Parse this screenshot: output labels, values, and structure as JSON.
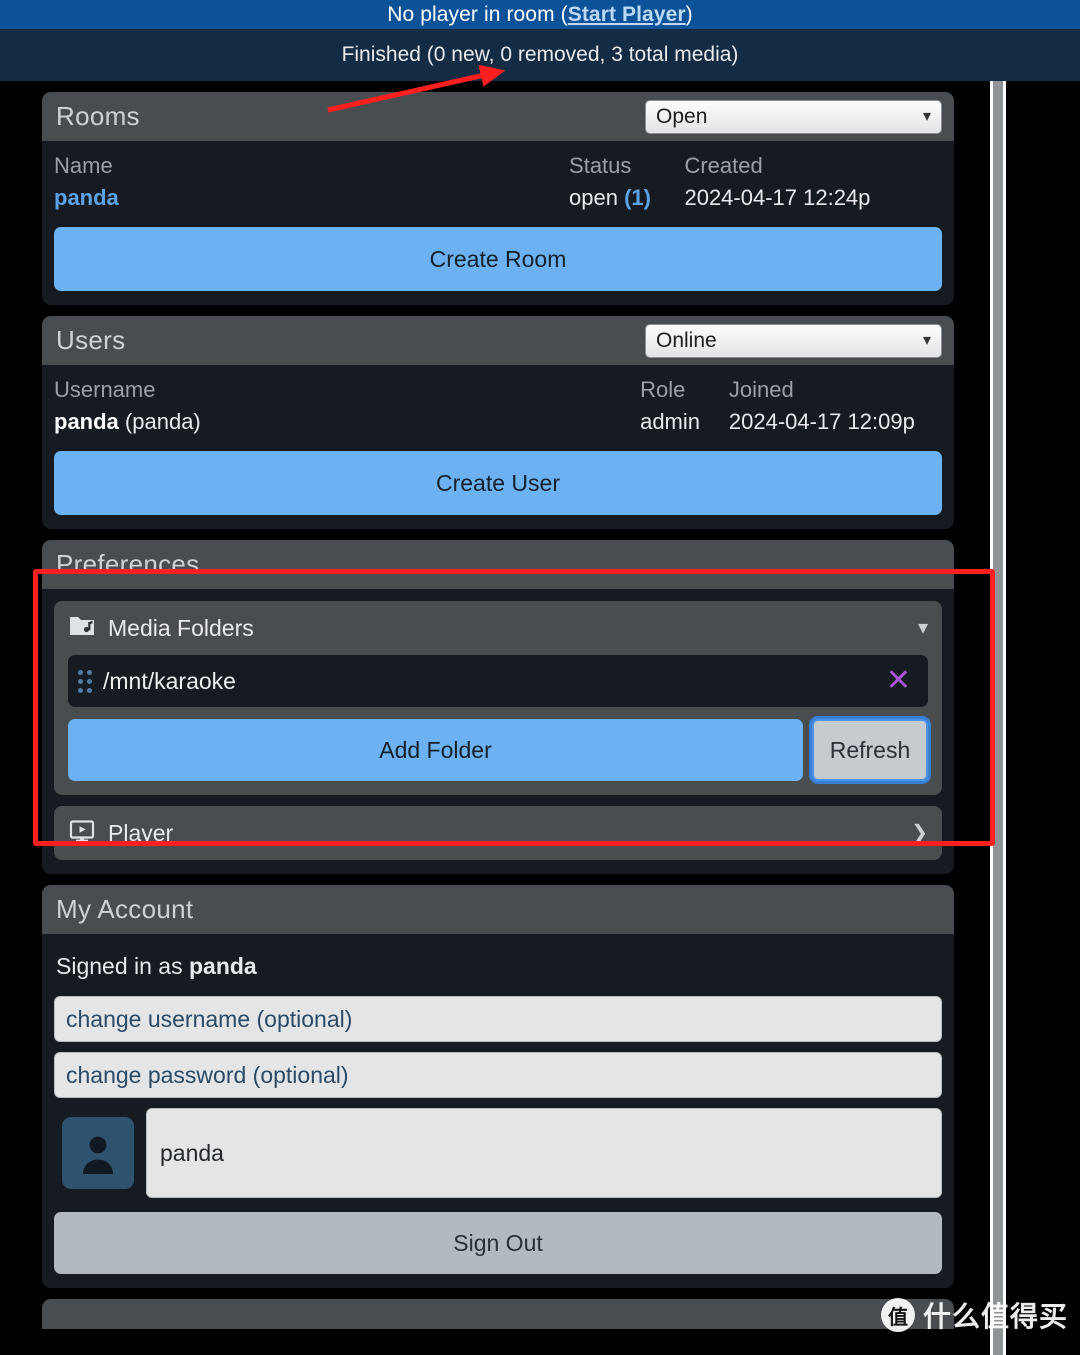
{
  "status_bars": {
    "player_prefix": "No player in room (",
    "player_link": "Start Player",
    "player_suffix": ")",
    "scan_status": "Finished (0 new, 0 removed, 3 total media)",
    "player_bar_color": "#0b5299",
    "scan_bar_color": "#132c44"
  },
  "rooms": {
    "title": "Rooms",
    "filter_value": "Open",
    "filter_options": [
      "Open"
    ],
    "columns": [
      "Name",
      "Status",
      "Created"
    ],
    "rows": [
      {
        "name": "panda",
        "status": "open",
        "count": "(1)",
        "created": "2024-04-17 12:24p"
      }
    ],
    "create_button": "Create Room"
  },
  "users": {
    "title": "Users",
    "filter_value": "Online",
    "filter_options": [
      "Online"
    ],
    "columns": [
      "Username",
      "Role",
      "Joined"
    ],
    "rows": [
      {
        "username_bold": "panda",
        "username_alias": "(panda)",
        "role": "admin",
        "joined": "2024-04-17 12:09p"
      }
    ],
    "create_button": "Create User"
  },
  "preferences": {
    "title": "Preferences",
    "media_folders": {
      "label": "Media Folders",
      "icon": "music-folder-icon",
      "expanded_caret": "chevron-down-icon",
      "folders": [
        {
          "path": "/mnt/karaoke",
          "remove_icon": "close-icon"
        }
      ],
      "add_button": "Add Folder",
      "refresh_button": "Refresh"
    },
    "player": {
      "label": "Player",
      "icon": "monitor-play-icon",
      "collapsed_caret": "chevron-right-icon"
    }
  },
  "my_account": {
    "title": "My Account",
    "signed_in_prefix": "Signed in as ",
    "signed_in_user": "panda",
    "username_placeholder": "change username (optional)",
    "username_value": "",
    "password_placeholder": "change password (optional)",
    "password_value": "",
    "avatar_icon": "user-avatar-icon",
    "display_name_value": "panda",
    "sign_out_button": "Sign Out"
  },
  "annotations": {
    "highlight_color": "#ff1f1f",
    "highlight_target": "preferences-panel",
    "arrow_target": "scan-status-text"
  },
  "watermark": {
    "badge": "值",
    "text": "什么值得买"
  },
  "theme": {
    "page_background": "#000000",
    "panel_body": "#161b22",
    "panel_header": "#4a4d50",
    "primary_button": "#6cb2f2",
    "link_blue": "#5ba3e8",
    "remove_purple": "#a855d4"
  }
}
